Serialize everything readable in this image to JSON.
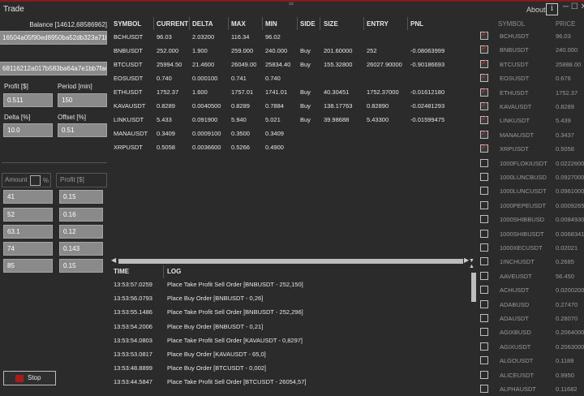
{
  "window": {
    "title": "Trade",
    "about_label": "About",
    "info_icon": "i",
    "resize_grip": "═",
    "controls": "─ ☐ ✕"
  },
  "left_panel": {
    "balance_label": "Balance [14612,68586962]",
    "api_key": "16504a05f90ed8950ba52db323a71b1",
    "api_secret": "68116212a017b583ba64a7e1bb7fae",
    "profit_label": "Profit [$]",
    "profit_value": "0.511",
    "period_label": "Period [min]",
    "period_value": "150",
    "delta_label": "Delta [%]",
    "delta_value": "10.0",
    "offset_label": "Offset [%]",
    "offset_value": "0.51",
    "amount_header": "Amount",
    "percent_label": "%",
    "profit_pct_header": "Profit [$]",
    "amounts": [
      "41",
      "52",
      "63.1",
      "74",
      "85"
    ],
    "profits": [
      "0.15",
      "0.16",
      "0.12",
      "0.143",
      "0.15"
    ],
    "stop_label": "Stop"
  },
  "trade_table": {
    "headers": [
      "SYMBOL",
      "CURRENT",
      "DELTA",
      "MAX",
      "MIN",
      "SIDE",
      "SIZE",
      "ENTRY",
      "PNL"
    ],
    "rows": [
      [
        "BCHUSDT",
        "96.03",
        "2.03200",
        "116.34",
        "96.02",
        "",
        "",
        "",
        ""
      ],
      [
        "BNBUSDT",
        "252.000",
        "1.900",
        "259.000",
        "240.000",
        "Buy",
        "201.60000",
        "252",
        "-0.08063999"
      ],
      [
        "BTCUSDT",
        "25994.50",
        "21.4600",
        "26049.00",
        "25834.40",
        "Buy",
        "155.32800",
        "26027.90000",
        "-0.90186693"
      ],
      [
        "EOSUSDT",
        "0.740",
        "0.000100",
        "0.741",
        "0.740",
        "",
        "",
        "",
        ""
      ],
      [
        "ETHUSDT",
        "1752.37",
        "1.600",
        "1757.01",
        "1741.01",
        "Buy",
        "40.30451",
        "1752.37000",
        "-0.01612180"
      ],
      [
        "KAVAUSDT",
        "0.8289",
        "0.0040500",
        "0.8289",
        "0.7884",
        "Buy",
        "138.17763",
        "0.82890",
        "-0.02481293"
      ],
      [
        "LINKUSDT",
        "5.433",
        "0.091900",
        "5.940",
        "5.021",
        "Buy",
        "39.98688",
        "5.43300",
        "-0.01599475"
      ],
      [
        "MANAUSDT",
        "0.3409",
        "0.0009100",
        "0.3500",
        "0.3409",
        "",
        "",
        "",
        ""
      ],
      [
        "XRPUSDT",
        "0.5058",
        "0.0036600",
        "0.5266",
        "0.4900",
        "",
        "",
        "",
        ""
      ]
    ]
  },
  "log": {
    "time_header": "TIME",
    "log_header": "LOG",
    "entries": [
      [
        "13:53:57.0259",
        "Place Take Profit Sell Order [BNBUSDT - 252,150]"
      ],
      [
        "13:53:56.0793",
        "Place Buy Order [BNBUSDT - 0,26]"
      ],
      [
        "13:53:55.1486",
        "Place Take Profit Sell Order [BNBUSDT - 252,296]"
      ],
      [
        "13:53:54.2006",
        "Place Buy Order [BNBUSDT - 0,21]"
      ],
      [
        "13:53:54.0803",
        "Place Take Profit Sell Order [KAVAUSDT - 0,8297]"
      ],
      [
        "13:53:53.0817",
        "Place Buy Order [KAVAUSDT - 65,0]"
      ],
      [
        "13:53:48.8899",
        "Place Buy Order [BTCUSDT - 0,002]"
      ],
      [
        "13:53:44.5847",
        "Place Take Profit Sell Order [BTCUSDT - 26054,57]"
      ]
    ]
  },
  "symbols_panel": {
    "symbol_header": "SYMBOL",
    "price_header": "PRICE",
    "rows": [
      {
        "checked": true,
        "symbol": "BCHUSDT",
        "price": "96.03"
      },
      {
        "checked": true,
        "symbol": "BNBUSDT",
        "price": "240.000"
      },
      {
        "checked": true,
        "symbol": "BTCUSDT",
        "price": "25888.00"
      },
      {
        "checked": true,
        "symbol": "EOSUSDT",
        "price": "0.676"
      },
      {
        "checked": true,
        "symbol": "ETHUSDT",
        "price": "1752.37"
      },
      {
        "checked": true,
        "symbol": "KAVAUSDT",
        "price": "0.8289"
      },
      {
        "checked": true,
        "symbol": "LINKUSDT",
        "price": "5.439"
      },
      {
        "checked": true,
        "symbol": "MANAUSDT",
        "price": "0.3437"
      },
      {
        "checked": true,
        "symbol": "XRPUSDT",
        "price": "0.5058"
      },
      {
        "checked": false,
        "symbol": "1000FLOKIUSDT",
        "price": "0.0222600"
      },
      {
        "checked": false,
        "symbol": "1000LUNCBUSD",
        "price": "0.0927000"
      },
      {
        "checked": false,
        "symbol": "1000LUNCUSDT",
        "price": "0.0961000"
      },
      {
        "checked": false,
        "symbol": "1000PEPEUSDT",
        "price": "0.0009265"
      },
      {
        "checked": false,
        "symbol": "1000SHIBBUSD",
        "price": "0.0084930"
      },
      {
        "checked": false,
        "symbol": "1000SHIBUSDT",
        "price": "0.0068341"
      },
      {
        "checked": false,
        "symbol": "1000XECUSDT",
        "price": "0.02021"
      },
      {
        "checked": false,
        "symbol": "1INCHUSDT",
        "price": "0.2685"
      },
      {
        "checked": false,
        "symbol": "AAVEUSDT",
        "price": "56.450"
      },
      {
        "checked": false,
        "symbol": "ACHUSDT",
        "price": "0.0200200"
      },
      {
        "checked": false,
        "symbol": "ADABUSD",
        "price": "0.27470"
      },
      {
        "checked": false,
        "symbol": "ADAUSDT",
        "price": "0.28070"
      },
      {
        "checked": false,
        "symbol": "AGIXBUSD",
        "price": "0.2064000"
      },
      {
        "checked": false,
        "symbol": "AGIXUSDT",
        "price": "0.2063000"
      },
      {
        "checked": false,
        "symbol": "ALGOUSDT",
        "price": "0.1188"
      },
      {
        "checked": false,
        "symbol": "ALICEUSDT",
        "price": "0.9950"
      },
      {
        "checked": false,
        "symbol": "ALPHAUSDT",
        "price": "0.11682"
      }
    ]
  },
  "colors": {
    "background": "#2b2b2b",
    "field_bg": "#8a8a8a",
    "accent_red": "#a81c1c",
    "check_red": "#d22a2a"
  }
}
